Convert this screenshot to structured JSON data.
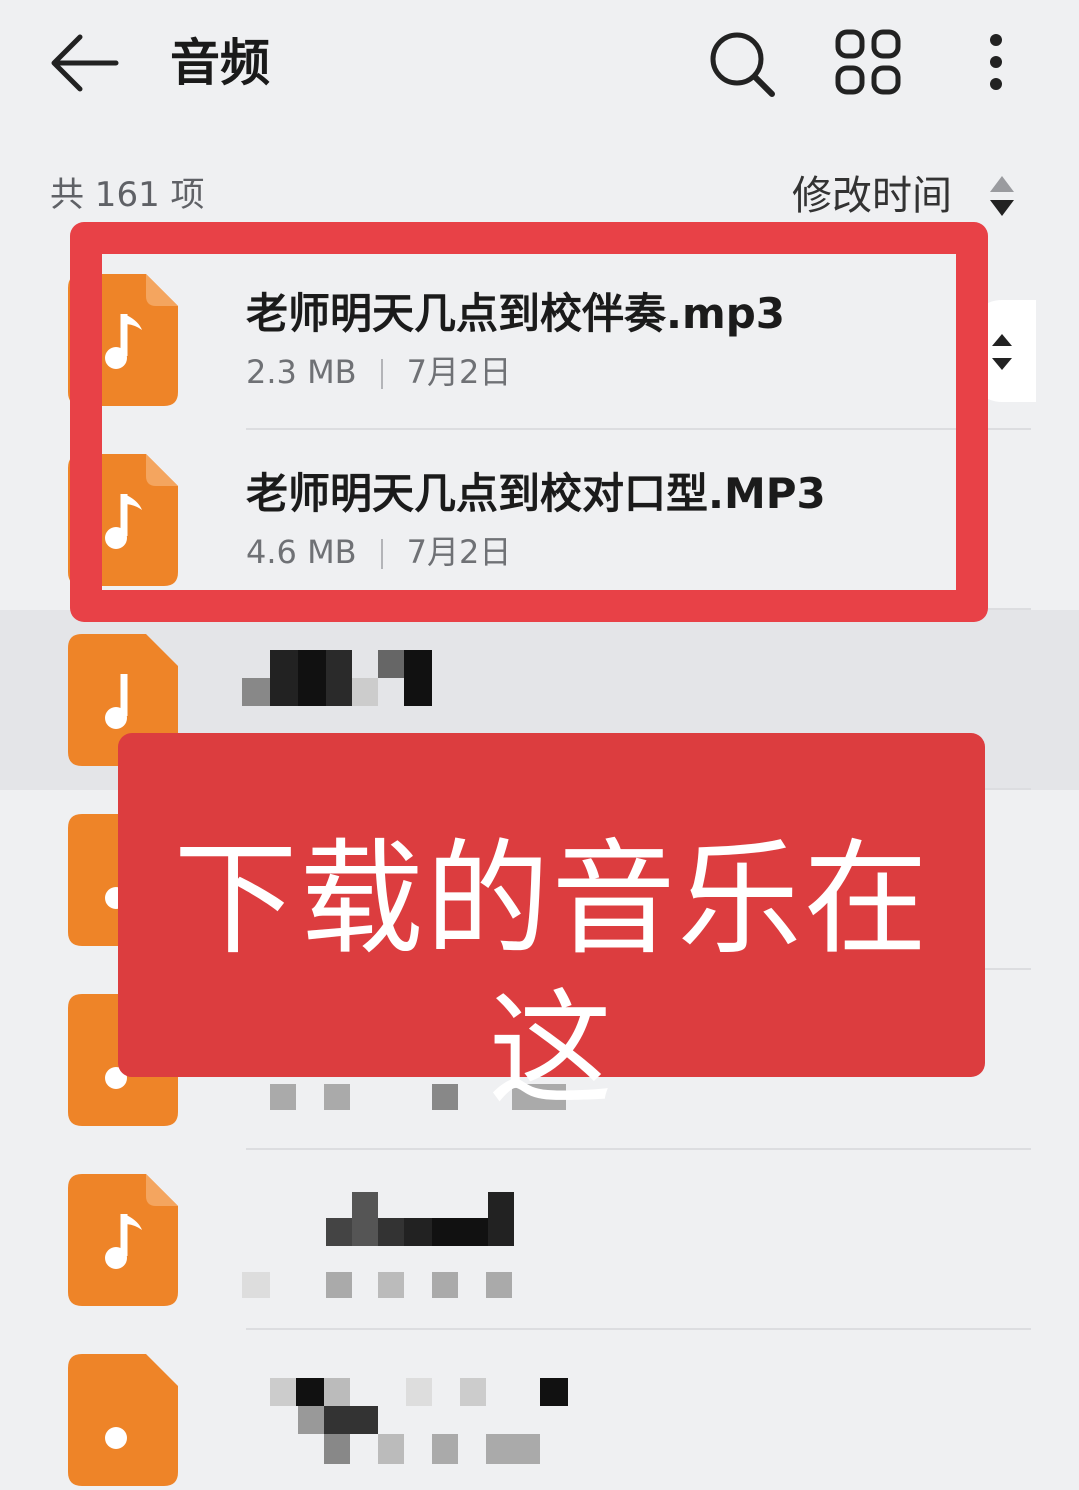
{
  "header": {
    "title": "音频",
    "back_icon": "arrow-left-icon",
    "search_icon": "search-icon",
    "grid_icon": "grid-view-icon",
    "more_icon": "more-vertical-icon"
  },
  "summary": {
    "count_label": "共 161 项",
    "sort_label": "修改时间",
    "sort_icon": "sort-toggle-icon"
  },
  "files": [
    {
      "name": "老师明天几点到校伴奏.mp3",
      "size": "2.3 MB",
      "date": "7月2日"
    },
    {
      "name": "老师明天几点到校对口型.MP3",
      "size": "4.6 MB",
      "date": "7月2日"
    }
  ],
  "overlay": {
    "banner_text": "下载的音乐在这",
    "highlight_color": "#e84147",
    "banner_color": "#dc3d3f"
  },
  "colors": {
    "icon_orange": "#ee8428",
    "background": "#eff0f2"
  }
}
